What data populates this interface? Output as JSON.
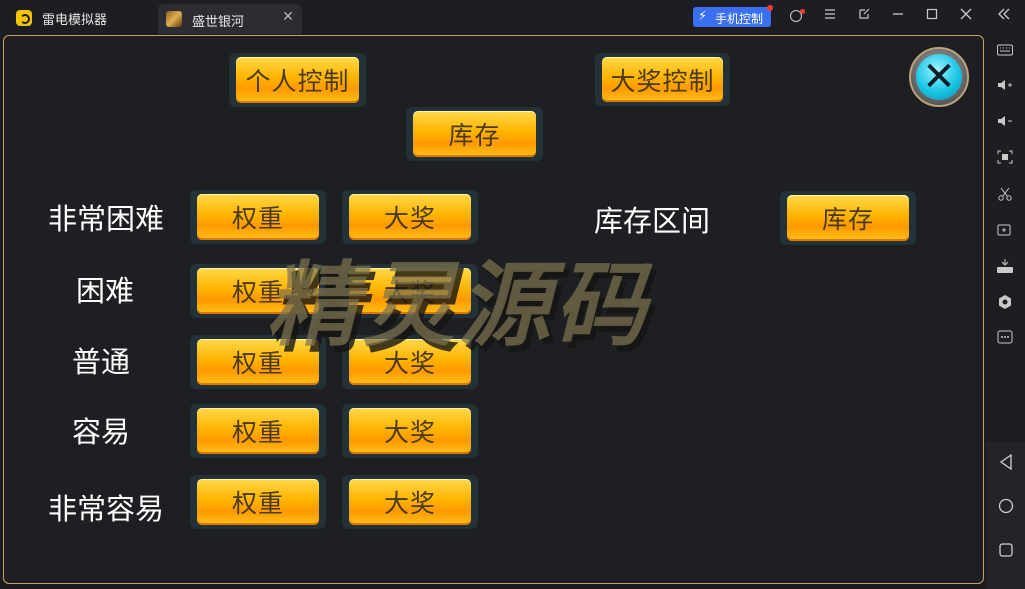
{
  "window": {
    "app_title": "雷电模拟器",
    "tab_title": "盛世银河",
    "tab_close": "✕",
    "phone_control": "手机控制",
    "phone_control_icon": "⚡"
  },
  "titlebar_icons": [
    "user-icon",
    "menu-icon",
    "popout-icon",
    "minimize-icon",
    "maximize-icon",
    "close-icon",
    "collapse-icon"
  ],
  "game": {
    "top_buttons": {
      "personal_control": "个人控制",
      "jackpot_control": "大奖控制",
      "inventory": "库存"
    },
    "rows": [
      {
        "label": "非常困难",
        "weight": "权重",
        "jackpot": "大奖"
      },
      {
        "label": "困难",
        "weight": "权重",
        "jackpot": "大奖"
      },
      {
        "label": "普通",
        "weight": "权重",
        "jackpot": "大奖"
      },
      {
        "label": "容易",
        "weight": "权重",
        "jackpot": "大奖"
      },
      {
        "label": "非常容易",
        "weight": "权重",
        "jackpot": "大奖"
      }
    ],
    "inventory_range": {
      "label": "库存区间",
      "button": "库存"
    },
    "close_glyph": "✕",
    "watermark": "精灵源码"
  },
  "sidebar_icons": [
    "keyboard-icon",
    "volume-up-icon",
    "volume-down-icon",
    "screenshot-icon",
    "scissors-icon",
    "add-app-icon",
    "apk-icon",
    "settings-icon",
    "more-icon"
  ],
  "nav_icons": [
    "back-icon",
    "home-icon",
    "recent-apps-icon"
  ],
  "colors": {
    "accent": "#3a6ff0",
    "button_gold": "#ffb400",
    "frame_border": "#c3a36a"
  }
}
